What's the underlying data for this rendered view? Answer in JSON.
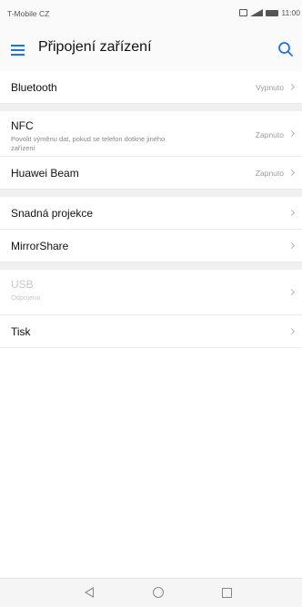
{
  "status_bar": {
    "carrier": "T-Mobile CZ",
    "time": "11:00"
  },
  "app_bar": {
    "title": "Připojení zařízení",
    "menu_icon": "menu-icon",
    "search_icon": "search-icon",
    "accent_color": "#1a73e8"
  },
  "settings": {
    "bluetooth": {
      "label": "Bluetooth",
      "value": "Vypnuto"
    },
    "nfc": {
      "label": "NFC",
      "subtitle": "Povolit výměnu dat, pokud se telefon dotkne jiného zařízení",
      "value": "Zapnuto"
    },
    "huawei_beam": {
      "label": "Huawei Beam",
      "value": "Zapnuto"
    },
    "snadna_projekce": {
      "label": "Snadná projekce"
    },
    "mirrorshare": {
      "label": "MirrorShare"
    },
    "usb": {
      "label": "USB",
      "subtitle": "Odpojeno"
    },
    "tisk": {
      "label": "Tisk"
    }
  },
  "nav_bar": {
    "back_icon": "back-triangle-icon",
    "home_icon": "home-circle-icon",
    "recents_icon": "recents-square-icon"
  }
}
